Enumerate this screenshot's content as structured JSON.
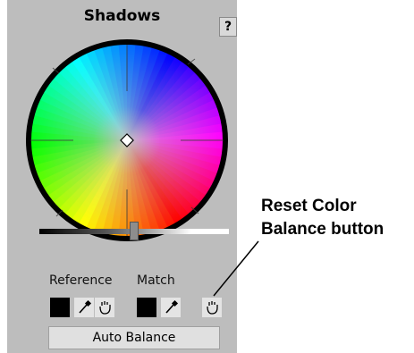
{
  "panel": {
    "title": "Shadows",
    "help_label": "?",
    "slider_level": 0.5,
    "reference_label": "Reference",
    "match_label": "Match",
    "reference_color": "#000000",
    "match_color": "#000000",
    "auto_balance_label": "Auto Balance"
  },
  "icons": {
    "help": "question-mark-icon",
    "eyedropper": "eyedropper-icon",
    "reset": "hand-reset-icon"
  },
  "callout": {
    "line1": "Reset Color",
    "line2": "Balance button"
  }
}
